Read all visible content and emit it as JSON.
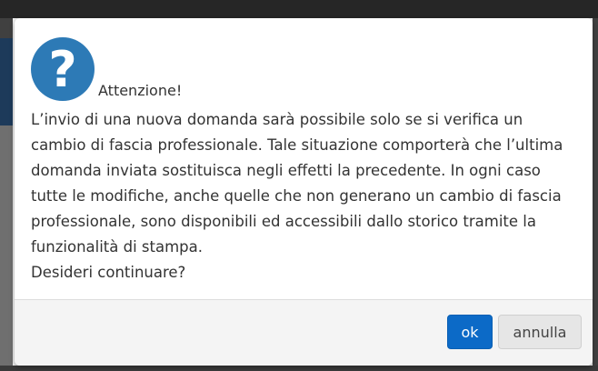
{
  "dialog": {
    "icon": "question-mark-icon",
    "title": "Attenzione!",
    "message_lines": [
      "L’invio di una nuova domanda sarà possibile solo se si verifica un",
      "cambio di fascia professionale. Tale situazione comporterà che l’ultima",
      "domanda inviata sostituisca negli effetti la precedente. In ogni caso",
      "tutte le modifiche, anche quelle che non generano un cambio di fascia",
      "professionale, sono disponibili ed accessibili dallo storico tramite la",
      "funzionalità di stampa.",
      "Desideri continuare?"
    ],
    "ok_label": "ok",
    "cancel_label": "annulla"
  },
  "colors": {
    "icon_bg": "#2d7ab6",
    "ok_button": "#0c6ac7",
    "cancel_button": "#e6e6e6",
    "text": "#333333"
  }
}
